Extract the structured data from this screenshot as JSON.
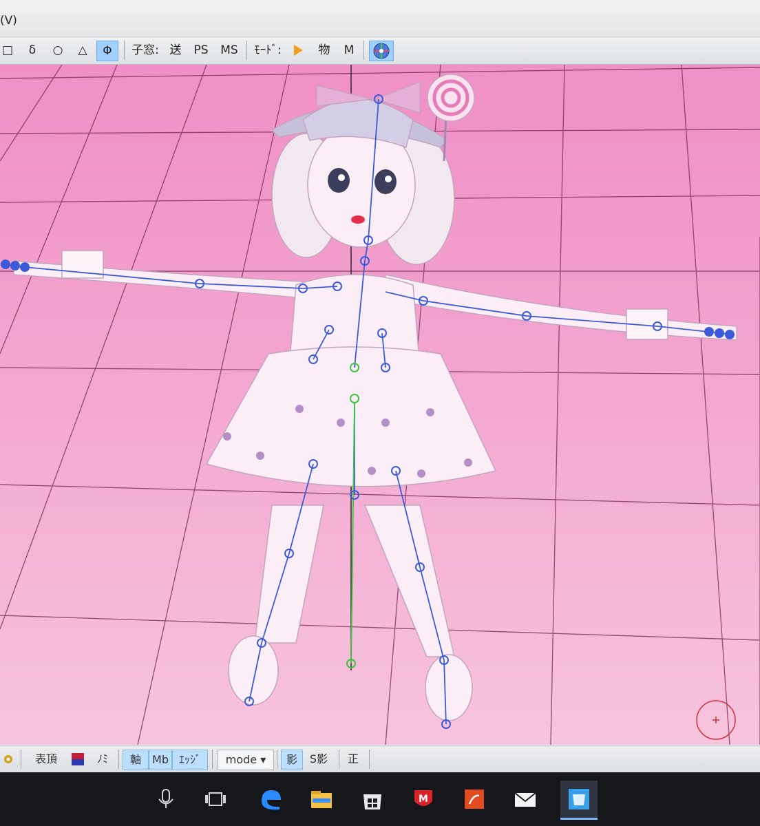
{
  "menubar": {
    "item": "(V)"
  },
  "toolbar": {
    "shape_square": "□",
    "shape_delta": "δ",
    "shape_circle": "○",
    "shape_triangle": "△",
    "shape_phi": "Φ",
    "child_window_label": "子窓:",
    "send_label": "送",
    "ps_label": "PS",
    "ms_label": "MS",
    "mode_label": "ﾓｰﾄﾞ:",
    "object_label": "物",
    "m_label": "M"
  },
  "bottombar": {
    "surface_vertex": "表頂",
    "normal_label": "ﾉﾐ",
    "axis_label": "軸",
    "mb_label": "Mb",
    "edge_label": "ｴｯｼﾞ",
    "mode_select": "mode",
    "shadow_label": "影",
    "s_shadow_label": "S影",
    "correct_label": "正"
  },
  "colors": {
    "viewport_top": "#ef8fc6",
    "bone": "#3b5bd9",
    "center_bone": "#3cc43c",
    "active_button": "#9fd0ff"
  },
  "icons": {
    "toolbar": [
      "play-icon",
      "globe-gizmo-icon"
    ],
    "taskbar": [
      "microphone-icon",
      "task-view-icon",
      "edge-browser-icon",
      "file-explorer-icon",
      "store-icon",
      "mcafee-icon",
      "app-red-icon",
      "mail-icon",
      "pmx-editor-icon"
    ]
  }
}
